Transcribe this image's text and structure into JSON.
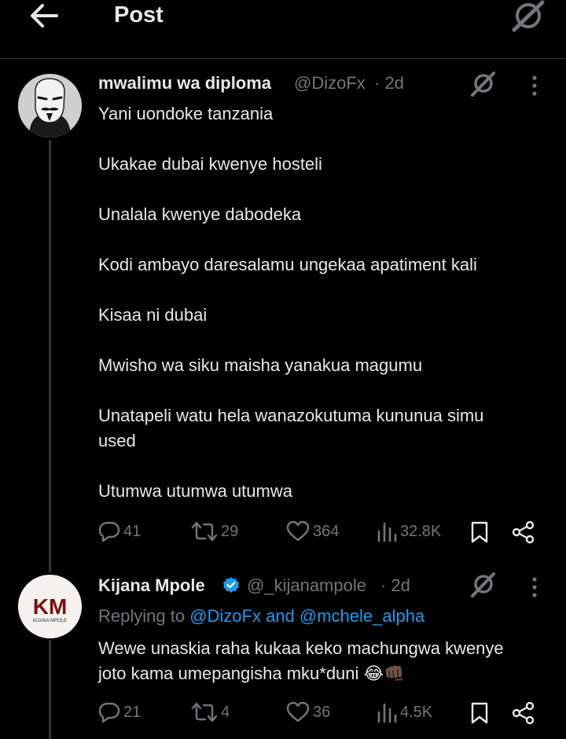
{
  "header": {
    "title": "Post"
  },
  "post": {
    "author_name": "mwalimu wa diploma",
    "handle": "@DizoFx",
    "time": "· 2d",
    "lines": [
      "Yani uondoke tanzania",
      "Ukakae dubai  kwenye hosteli",
      "Unalala kwenye dabodeka",
      "Kodi ambayo daresalamu ungekaa apatiment kali",
      "Kisaa ni dubai",
      "Mwisho wa siku maisha yanakua magumu",
      "Unatapeli watu hela wanazokutuma kununua simu",
      "used",
      "Utumwa utumwa utumwa"
    ],
    "stats": {
      "replies": "41",
      "reposts": "29",
      "likes": "364",
      "views": "32.8K"
    }
  },
  "reply": {
    "author_name": "Kijana Mpole",
    "handle": "@_kijanampole",
    "time": "· 2d",
    "avatar_text": "KM",
    "avatar_subtext": "KIJANA MPOLE",
    "replying_prefix": "Replying to ",
    "replying_users": "@DizoFx and @mchele_alpha",
    "lines": [
      "Wewe unaskia raha kukaa keko machungwa kwenye",
      "joto kama umepangisha mku*duni 😂👊🏿"
    ],
    "stats": {
      "replies": "21",
      "reposts": "4",
      "likes": "36",
      "views": "4.5K"
    }
  },
  "colors": {
    "background": "#000000",
    "text": "#e7e9ea",
    "muted": "#71767b",
    "link": "#1d9bf0",
    "verified": "#1d9bf0"
  },
  "icons": [
    "back-arrow-icon",
    "grok-icon",
    "more-icon",
    "reply-icon",
    "repost-icon",
    "like-icon",
    "views-icon",
    "bookmark-icon",
    "share-icon",
    "verified-icon"
  ]
}
